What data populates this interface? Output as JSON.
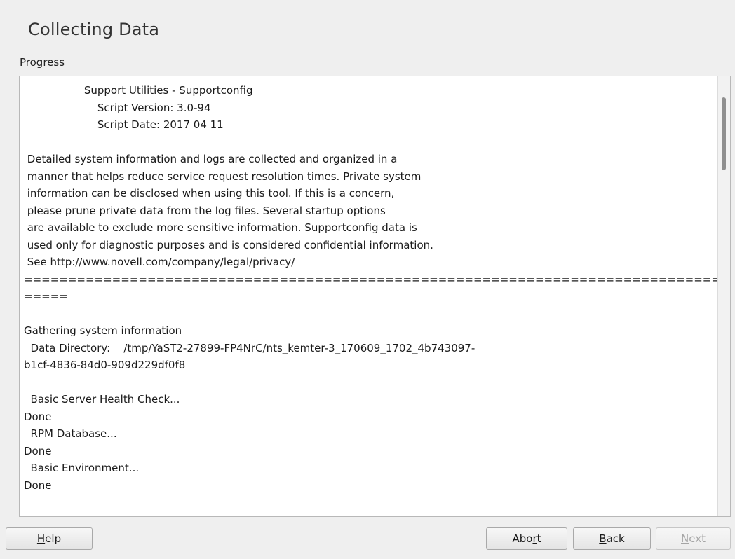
{
  "dialog": {
    "title": "Collecting Data",
    "progress_label_mnemonic": "P",
    "progress_label_rest": "rogress"
  },
  "log": {
    "lines": [
      "                  Support Utilities - Supportconfig",
      "                      Script Version: 3.0-94",
      "                      Script Date: 2017 04 11",
      "",
      " Detailed system information and logs are collected and organized in a",
      " manner that helps reduce service request resolution times. Private system",
      " information can be disclosed when using this tool. If this is a concern,",
      " please prune private data from the log files. Several startup options",
      " are available to exclude more sensitive information. Supportconfig data is",
      " used only for diagnostic purposes and is considered confidential information.",
      " See http://www.novell.com/company/legal/privacy/",
      "================================================================================",
      "=====",
      "",
      "Gathering system information",
      "  Data Directory:    /tmp/YaST2-27899-FP4NrC/nts_kemter-3_170609_1702_4b743097-",
      "b1cf-4836-84d0-909d229df0f8",
      "",
      "  Basic Server Health Check...",
      "Done",
      "  RPM Database...",
      "Done",
      "  Basic Environment...",
      "Done"
    ]
  },
  "buttons": {
    "help": {
      "mnemonic": "H",
      "rest": "elp"
    },
    "abort": {
      "pre": "Abo",
      "mnemonic": "r",
      "rest": "t"
    },
    "back": {
      "mnemonic": "B",
      "rest": "ack"
    },
    "next": {
      "mnemonic": "N",
      "rest": "ext",
      "disabled": true
    }
  },
  "colors": {
    "background": "#efefef",
    "log_background": "#ffffff",
    "scroll_thumb": "#8f8f8f",
    "disabled_text": "#a5a5a5"
  }
}
